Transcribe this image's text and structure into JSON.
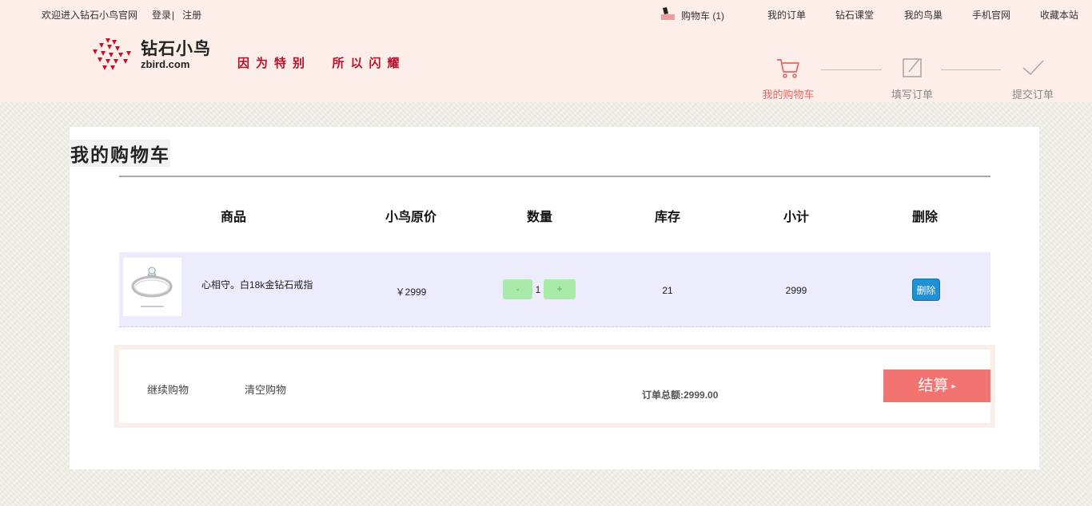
{
  "topbar": {
    "welcome": "欢迎进入钻石小鸟官网",
    "login": "登录",
    "separator": "|",
    "register": "注册",
    "cart": "购物车 (1)",
    "my_orders": "我的订单",
    "classroom": "钻石课堂",
    "my_nest": "我的鸟巢",
    "mobile_site": "手机官网",
    "bookmark": "收藏本站"
  },
  "brand": {
    "name_cn": "钻石小鸟",
    "name_en": "zbird.com",
    "slogan": "因为特别  所以闪耀",
    "logo_color": "#c8102e"
  },
  "steps": [
    {
      "label": "我的购物车",
      "icon": "cart-icon",
      "active": true
    },
    {
      "label": "填写订单",
      "icon": "edit-icon",
      "active": false
    },
    {
      "label": "提交订单",
      "icon": "check-icon",
      "active": false
    }
  ],
  "cart": {
    "title": "我的购物车",
    "columns": [
      "商品",
      "小鸟原价",
      "数量",
      "库存",
      "小计",
      "删除"
    ],
    "items": [
      {
        "name": "心相守。白18k金钻石戒指",
        "price": "￥2999",
        "qty_minus": "-",
        "quantity": "1",
        "qty_plus": "+",
        "stock": "21",
        "subtotal": "2999",
        "delete_label": "删除"
      }
    ],
    "continue_shopping": "继续购物",
    "clear_cart": "清空购物",
    "total": "订单总额:2999.00",
    "checkout": "结算",
    "checkout_arrow": "▸"
  },
  "colors": {
    "header_bg": "#fdeee9",
    "accent": "#f37370",
    "active_step": "#e8675f",
    "qty_button": "#a8eaa8",
    "delete_button": "#1f8fd6",
    "row_bg": "#ececfc"
  }
}
